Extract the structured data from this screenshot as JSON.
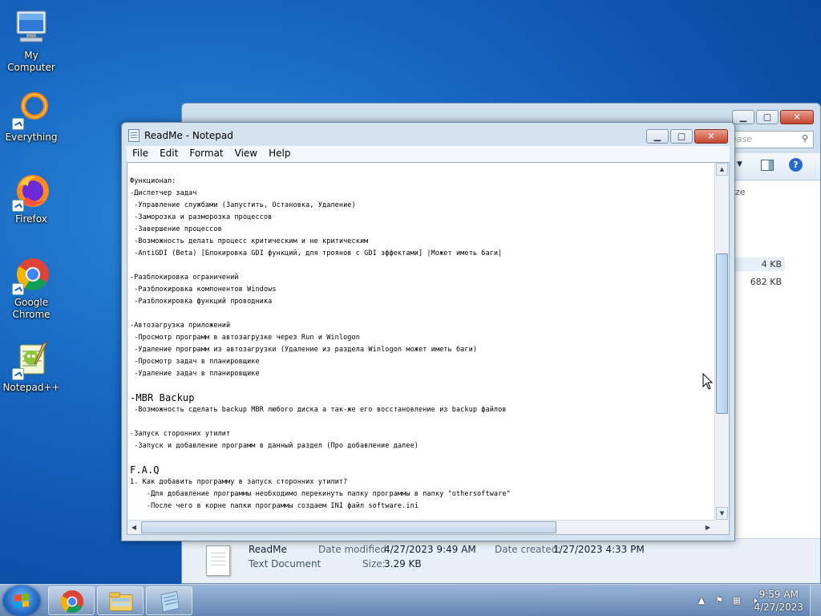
{
  "desktop": {
    "icons": [
      {
        "label": "My Computer",
        "icon": "computer-icon"
      },
      {
        "label": "Everything",
        "icon": "everything-icon"
      },
      {
        "label": "Firefox",
        "icon": "firefox-icon"
      },
      {
        "label": "Google Chrome",
        "icon": "chrome-icon"
      },
      {
        "label": "Notepad++",
        "icon": "notepadpp-icon"
      }
    ]
  },
  "explorer": {
    "search_placeholder": "ease",
    "column_size": "ze",
    "rows": [
      {
        "size": "4 KB"
      },
      {
        "size": "682 KB"
      }
    ],
    "details": {
      "name": "ReadMe",
      "type": "Text Document",
      "modified_label": "Date modified:",
      "modified": "4/27/2023 9:49 AM",
      "created_label": "Date created:",
      "created": "1/27/2023 4:33 PM",
      "size_label": "Size:",
      "size": "3.29 KB"
    }
  },
  "notepad": {
    "title": "ReadMe - Notepad",
    "menu": [
      "File",
      "Edit",
      "Format",
      "View",
      "Help"
    ],
    "lines": [
      "Функционал:",
      "-Диспетчер задач",
      " -Управление службами (Запустить, Остановка, Удаление)",
      " -Заморозка и разморозка процессов",
      " -Завершение процессов",
      " -Возможность делать процесс критическим и не критическим",
      " -AntiGDI (Beta) [Блокировка GDI функций, для троянов с GDI эффектами] |Может иметь баги|",
      "",
      "-Разблокировка ограничений",
      " -Разблокировка компонентов Windows",
      " -Разблокировка функций проводника",
      "",
      "-Автозагрузка приложений",
      " -Просмотр программ в автозагрузке через Run и Winlogon",
      " -Удаление программ из автозагрузки (Удаление из раздела Winlogon может иметь баги)",
      " -Просмотр задач в планировщике",
      " -Удаление задач в планировщике",
      "",
      "-MBR Backup",
      " -Возможность сделать backup MBR любого диска а так-же его восстановление из backup файлов",
      "",
      "-Запуск сторонних утилит",
      " -Запуск и добавление программ в данный раздел (Про добавление далее)",
      "",
      "F.A.Q",
      "1. Как добавить программу в запуск сторонних утилит?",
      "    -Для добавление программы необходимо перекинуть папку программы в папку \"othersoftware\"",
      "    -После чего в корне папки программы создаем INI файл software.ini"
    ]
  },
  "taskbar": {
    "time": "9:59 AM",
    "date": "4/27/2023",
    "pinned": [
      "chrome-icon",
      "explorer-icon",
      "notepad-icon"
    ]
  }
}
